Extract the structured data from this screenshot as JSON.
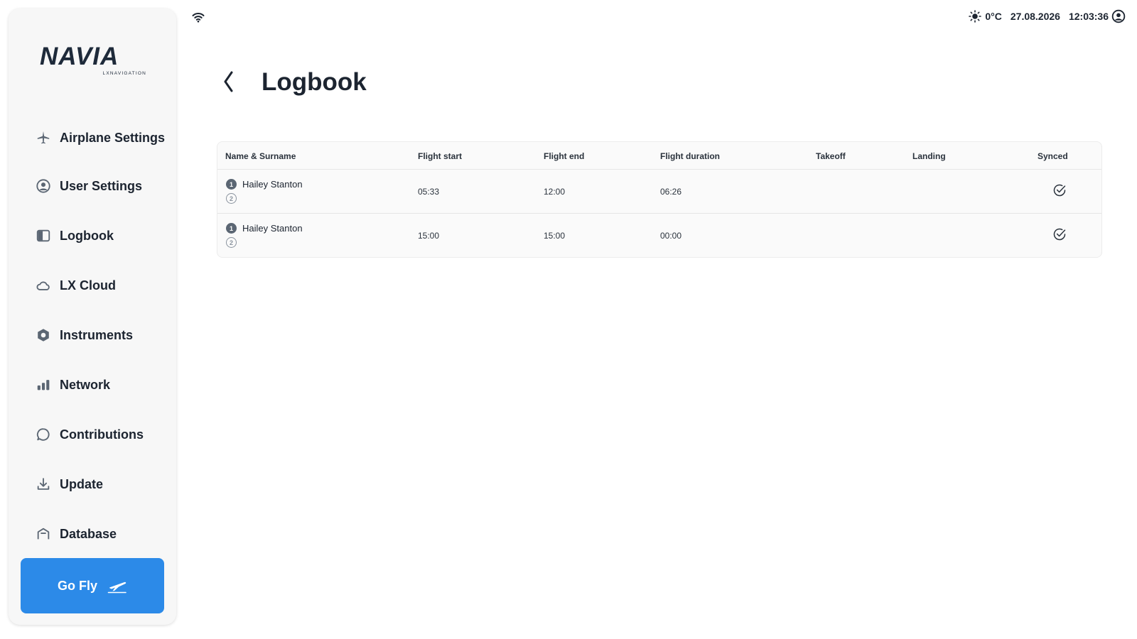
{
  "app": {
    "logo_main": "NAVIA",
    "logo_sub": "LXNAVIGATION"
  },
  "status": {
    "temperature": "0°C",
    "date": "27.08.2026",
    "time": "12:03:36"
  },
  "sidebar": {
    "items": [
      {
        "label": "Airplane Settings",
        "icon": "airplane-icon"
      },
      {
        "label": "User Settings",
        "icon": "user-circle-icon"
      },
      {
        "label": "Logbook",
        "icon": "book-icon"
      },
      {
        "label": "LX Cloud",
        "icon": "cloud-icon"
      },
      {
        "label": "Instruments",
        "icon": "hexagon-icon"
      },
      {
        "label": "Network",
        "icon": "signal-bars-icon"
      },
      {
        "label": "Contributions",
        "icon": "chat-bubble-icon"
      },
      {
        "label": "Update",
        "icon": "download-icon"
      },
      {
        "label": "Database",
        "icon": "database-icon"
      }
    ],
    "go_fly_label": "Go Fly"
  },
  "page": {
    "title": "Logbook"
  },
  "table": {
    "headers": [
      "Name & Surname",
      "Flight start",
      "Flight end",
      "Flight duration",
      "Takeoff",
      "Landing",
      "Synced"
    ],
    "rows": [
      {
        "pilot1": "Hailey Stanton",
        "pilot1_badge": "1",
        "pilot2_badge": "2",
        "start": "05:33",
        "end": "12:00",
        "duration": "06:26",
        "takeoff": "",
        "landing": "",
        "synced": true
      },
      {
        "pilot1": "Hailey Stanton",
        "pilot1_badge": "1",
        "pilot2_badge": "2",
        "start": "15:00",
        "end": "15:00",
        "duration": "00:00",
        "takeoff": "",
        "landing": "",
        "synced": true
      }
    ]
  },
  "colors": {
    "accent": "#2c8ae8",
    "text": "#1c2430",
    "sidebar_bg": "#f7f7f7"
  }
}
